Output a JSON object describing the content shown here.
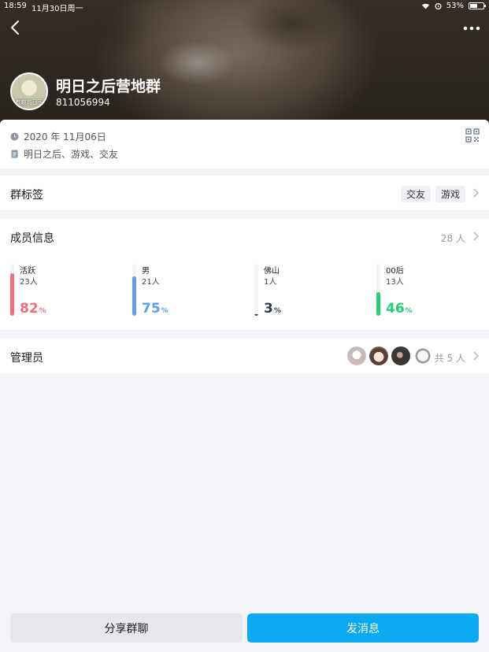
{
  "status_bar": {
    "time": "18:59",
    "date": "11月30日周一",
    "battery": "53%"
  },
  "group": {
    "name": "明日之后营地群",
    "id": "811056994",
    "avatar_caption": "有趣的日子"
  },
  "info": {
    "created": "2020 年 11月06日",
    "keywords": "明日之后、游戏、交友"
  },
  "tags_section": {
    "title": "群标签",
    "tags": [
      "交友",
      "游戏"
    ]
  },
  "members": {
    "title": "成员信息",
    "count": "28 人",
    "stats": [
      {
        "label": "活跃",
        "sub": "23人",
        "pct": "82",
        "unit": "%",
        "value": 0.82,
        "color": "#f56b7a"
      },
      {
        "label": "男",
        "sub": "21人",
        "pct": "75",
        "unit": "%",
        "value": 0.75,
        "color": "#5a9ef8"
      },
      {
        "label": "佛山",
        "sub": "1人",
        "pct": "3",
        "unit": "%",
        "value": 0.03,
        "color": "#2f3a56"
      },
      {
        "label": "00后",
        "sub": "13人",
        "pct": "46",
        "unit": "%",
        "value": 0.46,
        "color": "#21cf7a"
      }
    ]
  },
  "admins": {
    "title": "管理员",
    "total": "共 5 人"
  },
  "buttons": {
    "share": "分享群聊",
    "send": "发消息"
  }
}
